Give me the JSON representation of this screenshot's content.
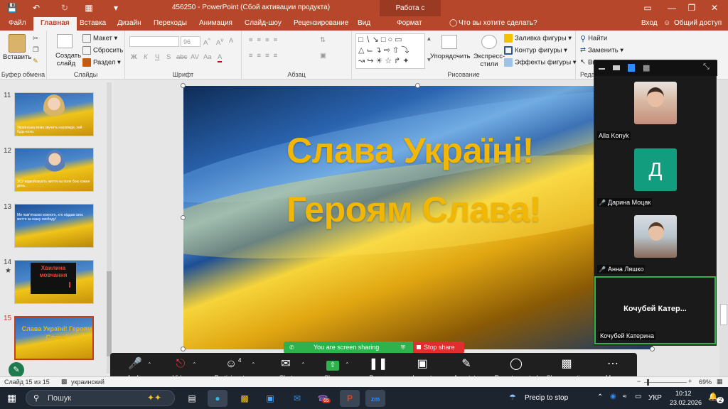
{
  "titlebar": {
    "title": "456250 - PowerPoint (Сбой активации продукта)",
    "context_tab": "Работа с рисунками"
  },
  "menu": {
    "items": [
      "Файл",
      "Главная",
      "Вставка",
      "Дизайн",
      "Переходы",
      "Анимация",
      "Слайд-шоу",
      "Рецензирование",
      "Вид",
      "Формат"
    ],
    "search": "Что вы хотите сделать?",
    "login": "Вход",
    "share": "Общий доступ"
  },
  "ribbon": {
    "clipboard": {
      "paste": "Вставить",
      "label": "Буфер обмена"
    },
    "slides": {
      "new_slide": "Создать слайд",
      "layout": "Макет",
      "reset": "Сбросить",
      "section": "Раздел",
      "label": "Слайды"
    },
    "font": {
      "size": "96",
      "label": "Шрифт",
      "bold": "Ж",
      "italic": "К",
      "underline": "Ч",
      "strike": "S",
      "abc": "abc",
      "spacing": "AV",
      "case": "Aa"
    },
    "paragraph": {
      "label": "Абзац"
    },
    "drawing": {
      "arrange": "Упорядочить",
      "styles": "Экспресс-стили",
      "fill": "Заливка фигуры",
      "outline": "Контур фигуры",
      "effects": "Эффекты фигуры",
      "label": "Рисование"
    },
    "editing": {
      "find": "Найти",
      "replace": "Заменить",
      "select": "Выделить",
      "label": "Реда"
    }
  },
  "thumbnails": [
    {
      "num": "11",
      "text": "Українська мова звучить назавжди, хай будь-коли."
    },
    {
      "num": "12",
      "text": "ЗСУ відвойовують життя на поле бою кожен день."
    },
    {
      "num": "13",
      "text": "Ми пам'ятаємо кожного, хто віддав своє життя за нашу свободу!"
    },
    {
      "num": "14",
      "text": "Хвилина мовчання"
    },
    {
      "num": "15",
      "text": "Слава Україні! Героям Слава!"
    }
  ],
  "slide": {
    "line1": "Слава Україні!",
    "line2": "Героям Слава!"
  },
  "participants_panel": {
    "participants": [
      {
        "name": "Alla Konyk",
        "avatar_letter": "",
        "muted": false
      },
      {
        "name": "Дарина Моцак",
        "avatar_letter": "Д",
        "muted": true
      },
      {
        "name": "Анна Ляшко",
        "avatar_letter": "",
        "muted": true
      },
      {
        "name": "Кочубей Катерина",
        "avatar_letter": "",
        "muted": false,
        "display": "Кочубей Катер..."
      }
    ]
  },
  "zoom": {
    "sharing_text": "You are screen sharing",
    "stop_share": "Stop share",
    "participants_count": "4",
    "toolbar": [
      "Audio",
      "Video",
      "Participants",
      "Chat",
      "Share",
      "Pause",
      "Layout",
      "Annotate",
      "Remote control",
      "Show meeting",
      "More"
    ]
  },
  "status": {
    "slide_info": "Слайд 15 из 15",
    "language": "украинский",
    "zoom_level": "69%"
  },
  "taskbar": {
    "search": "Пошук",
    "weather": "Precip to stop",
    "lang": "УКР",
    "time": "10:12",
    "date": "23.02.2026",
    "notif": "2",
    "viber_badge": "65"
  },
  "colors": {
    "accent": "#b7472a",
    "title_text": "#f2b705",
    "zoom_green": "#2eb24b",
    "zoom_red": "#e02d2d"
  }
}
